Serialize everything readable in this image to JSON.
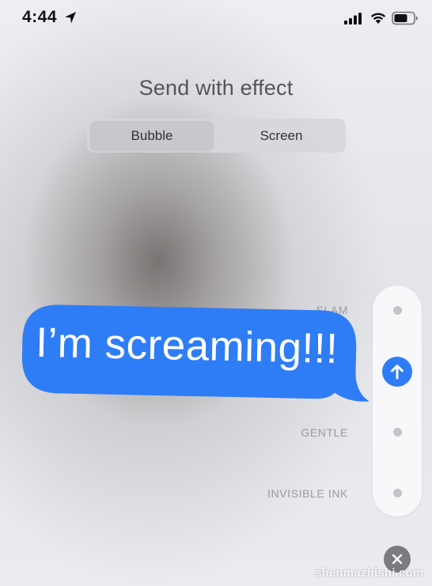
{
  "status_bar": {
    "time": "4:44",
    "icons": [
      "location-arrow-icon",
      "cellular-signal-icon",
      "wifi-icon",
      "battery-icon"
    ]
  },
  "title": "Send with effect",
  "tabs": [
    {
      "label": "Bubble",
      "selected": true
    },
    {
      "label": "Screen",
      "selected": false
    }
  ],
  "effects": {
    "slam": "SLAM",
    "gentle": "GENTLE",
    "invisible_ink": "INVISIBLE INK"
  },
  "message": {
    "text": "I’m screaming!!!"
  },
  "colors": {
    "bubble_blue": "#2f7df6",
    "send_button": "#2f7df6",
    "label_gray": "#9a9a9e"
  },
  "watermark": "shenmazhishi.com"
}
